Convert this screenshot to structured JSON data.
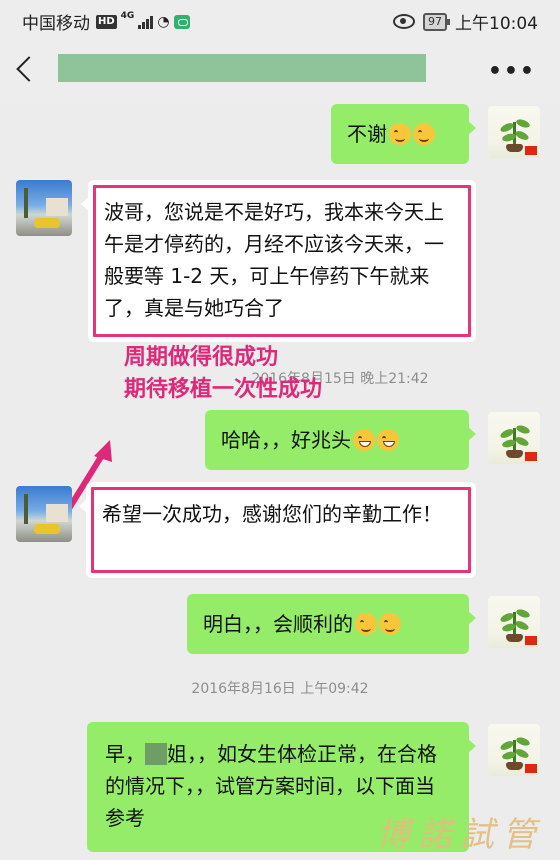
{
  "status_bar": {
    "carrier": "中国移动",
    "hd": "HD",
    "network": "4G",
    "battery": "97",
    "time": "上午10:04"
  },
  "nav": {
    "contact_name": "",
    "back_icon": "chevron-left-icon",
    "more_icon": "more-icon"
  },
  "messages": [
    {
      "side": "right",
      "text": "不谢",
      "emoji": [
        "smile",
        "smile"
      ]
    },
    {
      "side": "left",
      "text": "波哥，您说是不是好巧，我本来今天上午是才停药的，月经不应该今天来，一般要等 1-2 天，可上午停药下午就来了，真是与她巧合了"
    },
    {
      "side": "right",
      "text": "哈哈，，好兆头",
      "emoji": [
        "grin",
        "grin"
      ]
    },
    {
      "side": "left",
      "text": "希望一次成功，感谢您们的辛勤工作！"
    },
    {
      "side": "right",
      "text": "明白，，会顺利的",
      "emoji": [
        "smile",
        "smile"
      ]
    },
    {
      "side": "right",
      "text_prefix": "早，",
      "text_after_mask": "姐，，如女生体检正常，在合格的情况下，，试管方案时间，以下面当参考"
    }
  ],
  "timestamps": [
    "2016年8月15日 晚上21:42",
    "2016年8月16日 上午09:42"
  ],
  "annotation": {
    "line1": "周期做得很成功",
    "line2": "期待移植一次性成功",
    "color": "#e0287a"
  },
  "watermark": "博諾試管",
  "colors": {
    "bubble_green": "#95ec69",
    "highlight": "#e6337a"
  }
}
